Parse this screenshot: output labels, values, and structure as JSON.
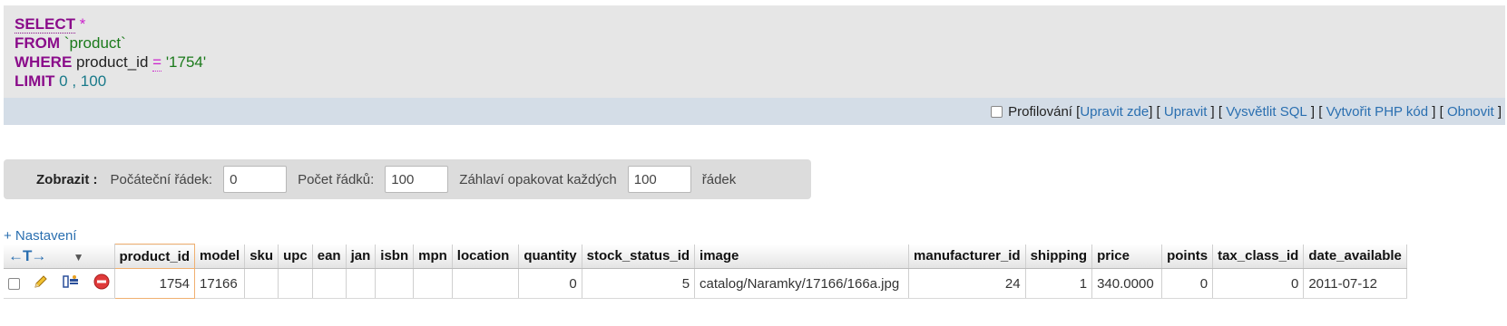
{
  "sql": {
    "select_kw": "SELECT",
    "star": "*",
    "from_kw": "FROM",
    "table": "`product`",
    "where_kw": "WHERE",
    "column": "product_id",
    "eq": "=",
    "value": "'1754'",
    "limit_kw": "LIMIT",
    "limit_start": "0",
    "limit_sep": ",",
    "limit_count": "100"
  },
  "actions": {
    "profiling_label": "Profilování",
    "items": [
      {
        "label": "Upravit zde"
      },
      {
        "label": "Upravit"
      },
      {
        "label": "Vysvětlit SQL"
      },
      {
        "label": "Vytvořit PHP kód"
      },
      {
        "label": "Obnovit"
      }
    ]
  },
  "display": {
    "label": "Zobrazit :",
    "start_row_label": "Počáteční řádek:",
    "start_row_value": "0",
    "row_count_label": "Počet řádků:",
    "row_count_value": "100",
    "repeat_header_label": "Záhlaví opakovat každých",
    "repeat_header_value": "100",
    "rows_suffix": "řádek"
  },
  "settings_link": "+ Nastavení",
  "table": {
    "nav_arrows": "←T→",
    "columns": [
      "product_id",
      "model",
      "sku",
      "upc",
      "ean",
      "jan",
      "isbn",
      "mpn",
      "location",
      "quantity",
      "stock_status_id",
      "image",
      "manufacturer_id",
      "shipping",
      "price",
      "points",
      "tax_class_id",
      "date_available"
    ],
    "rows": [
      {
        "product_id": "1754",
        "model": "17166",
        "sku": "",
        "upc": "",
        "ean": "",
        "jan": "",
        "isbn": "",
        "mpn": "",
        "location": "",
        "quantity": "0",
        "stock_status_id": "5",
        "image": "catalog/Naramky/17166/166a.jpg",
        "manufacturer_id": "24",
        "shipping": "1",
        "price": "340.0000",
        "points": "0",
        "tax_class_id": "0",
        "date_available": "2011-07-12"
      }
    ]
  },
  "icons": [
    "pencil-icon",
    "inline-edit-icon",
    "delete-icon"
  ],
  "colors": {
    "keyword": "#8a0c8a",
    "string": "#1b7a1b",
    "number": "#1a7a8a",
    "link": "#2a6fb0",
    "sql_bg": "#e6e6e6",
    "action_bg": "#d4dde7"
  }
}
